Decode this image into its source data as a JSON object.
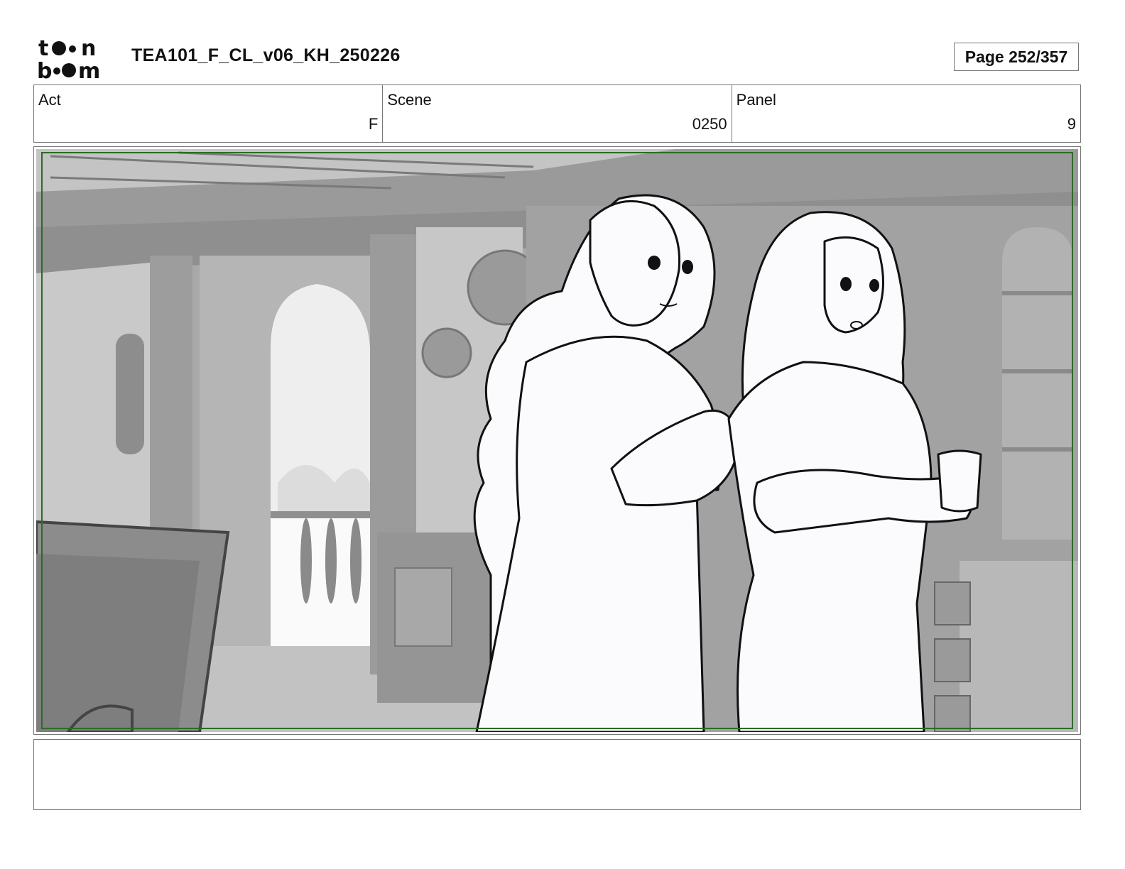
{
  "header": {
    "logo_top": "to•n",
    "logo_bottom": "b••m",
    "document_title": "TEA101_F_CL_v06_KH_250226",
    "page_label": "Page 252/357"
  },
  "info": {
    "act_label": "Act",
    "act_value": "F",
    "scene_label": "Scene",
    "scene_value": "0250",
    "panel_label": "Panel",
    "panel_value": "9"
  },
  "panel": {
    "image_icon": "storyboard-sketch-interior-two-women",
    "safe_frame_color": "#2e6b2a"
  },
  "notes": {
    "text": ""
  }
}
